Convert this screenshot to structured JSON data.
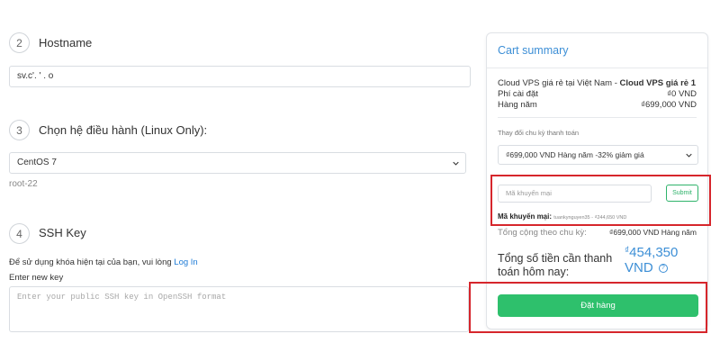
{
  "steps": [
    {
      "number": "2",
      "title": "Hostname"
    },
    {
      "number": "3",
      "title": "Chọn hệ điều hành (Linux Only):"
    },
    {
      "number": "4",
      "title": "SSH Key"
    }
  ],
  "hostname": {
    "value": "sv.c'. ' .          o"
  },
  "os": {
    "selected": "CentOS 7",
    "root_user": "root-22"
  },
  "ssh": {
    "login_prompt_prefix": "Để sử dụng khóa hiện tại của bạn, vui lòng",
    "login_link": "Log In",
    "new_key_label": "Enter new key",
    "placeholder": "Enter your public SSH key in OpenSSH format"
  },
  "cart": {
    "title": "Cart summary",
    "product_prefix": "Cloud VPS giá rẻ tại Việt Nam - ",
    "product_name": "Cloud VPS giá rẻ 1",
    "setup_fee_label": "Phí cài đặt",
    "setup_fee_value": "₫0 VND",
    "annual_label": "Hàng năm",
    "annual_value": "₫699,000 VND",
    "change_cycle_label": "Thay đổi chu kỳ thanh toán",
    "cycle_selected": "₫699,000 VND Hàng năm -32% giảm giá",
    "promo_placeholder": "Mã khuyến mại",
    "submit_label": "Submit",
    "promo_applied_label": "Mã khuyến mại:",
    "promo_applied_code": "tuankynguyen35 - ₫244,650 VND",
    "cycle_total_label": "Tổng cộng theo chu kỳ:",
    "cycle_total_value": "₫699,000 VND  Hàng năm",
    "due_today_label": "Tổng số tiền cần thanh toán hôm nay:",
    "due_today_currency": "₫",
    "due_today_value": "454,350",
    "due_today_unit": "VND",
    "help_symbol": "?",
    "order_button": "Đặt hàng"
  },
  "colors": {
    "accent_blue": "#3d8fd6",
    "order_green": "#2ec06c",
    "annotation_red": "#d6262c"
  }
}
